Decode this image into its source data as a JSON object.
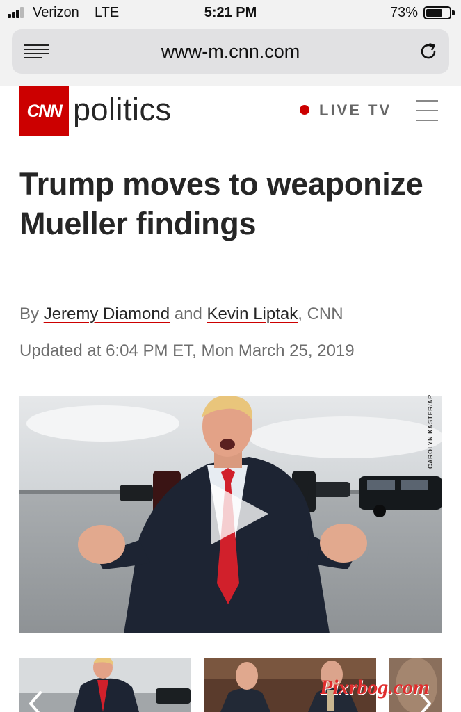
{
  "status_bar": {
    "carrier": "Verizon",
    "network": "LTE",
    "time": "5:21 PM",
    "battery_percent": "73%",
    "battery_level": 0.73,
    "signal_bars": 3
  },
  "browser": {
    "url": "www-m.cnn.com",
    "icons": [
      "reader-view-icon",
      "reload-icon"
    ]
  },
  "site_header": {
    "logo": "CNN",
    "section": "politics",
    "live_label": "LIVE TV",
    "icons": [
      "live-dot-icon",
      "hamburger-menu-icon"
    ]
  },
  "article": {
    "headline": "Trump moves to weaponize Mueller findings",
    "byline": {
      "prefix": "By ",
      "author_1": "Jeremy Diamond",
      "joiner": " and ",
      "author_2": "Kevin Liptak",
      "suffix": ", CNN"
    },
    "updated": "Updated at 6:04 PM ET, Mon March 25, 2019",
    "video": {
      "photo_credit": "CAROLYN KASTER/AP",
      "icon": "play-icon"
    }
  },
  "gallery": {
    "icons": [
      "chevron-left-icon",
      "chevron-right-icon"
    ]
  },
  "watermark": "Pixrbog.com",
  "colors": {
    "brand_red": "#cc0000",
    "headline_text": "#262626",
    "meta_text": "#6e6e6e",
    "browser_chrome": "#f2f2f2",
    "url_field": "#e1e1e3"
  }
}
